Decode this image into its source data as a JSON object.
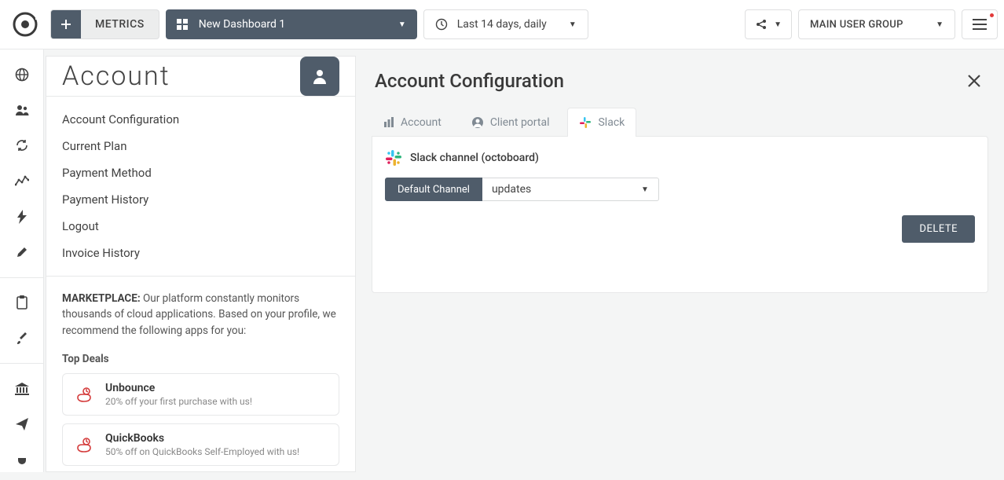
{
  "topbar": {
    "metrics_label": "METRICS",
    "dashboard_label": "New Dashboard 1",
    "date_label": "Last 14 days, daily",
    "usergroup_label": "MAIN USER GROUP"
  },
  "sidebar": {
    "title": "Account",
    "nav": [
      "Account Configuration",
      "Current Plan",
      "Payment Method",
      "Payment History",
      "Logout",
      "Invoice History"
    ],
    "marketplace_label": "MARKETPLACE:",
    "marketplace_text": " Our platform constantly monitors thousands of cloud applications. Based on your profile, we recommend the following apps for you:",
    "top_deals_label": "Top Deals",
    "deals": [
      {
        "name": "Unbounce",
        "desc": "20% off your first purchase with us!"
      },
      {
        "name": "QuickBooks",
        "desc": "50% off on QuickBooks Self-Employed with us!"
      }
    ]
  },
  "main": {
    "title": "Account Configuration",
    "tabs": [
      {
        "label": "Account"
      },
      {
        "label": "Client portal"
      },
      {
        "label": "Slack"
      }
    ],
    "slack_title": "Slack channel (octoboard)",
    "channel_label_text": "Default Channel",
    "channel_value": "updates",
    "delete_label": "DELETE"
  },
  "icons": {
    "globe": "globe-icon",
    "users": "users-icon",
    "dashboard": "dashboard-icon",
    "share": "share-icon",
    "flash": "flash-icon",
    "pencil": "pencil-icon",
    "clipboard": "clipboard-icon",
    "brush": "brush-icon",
    "bank": "bank-icon",
    "send": "send-icon",
    "plug": "plug-icon"
  }
}
